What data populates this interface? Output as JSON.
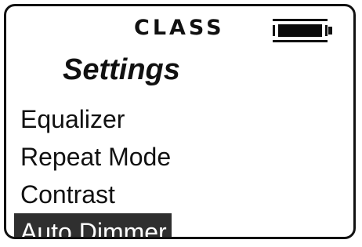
{
  "header": {
    "brand": "CLASS",
    "battery_level": 1.0
  },
  "screen": {
    "title": "Settings"
  },
  "menu": {
    "items": [
      {
        "label": "Equalizer",
        "selected": false
      },
      {
        "label": "Repeat Mode",
        "selected": false
      },
      {
        "label": "Contrast",
        "selected": false
      },
      {
        "label": "Auto Dimmer",
        "selected": true
      }
    ]
  },
  "colors": {
    "selection_bg": "#2f2f2f",
    "text": "#111111",
    "background": "#ffffff"
  }
}
